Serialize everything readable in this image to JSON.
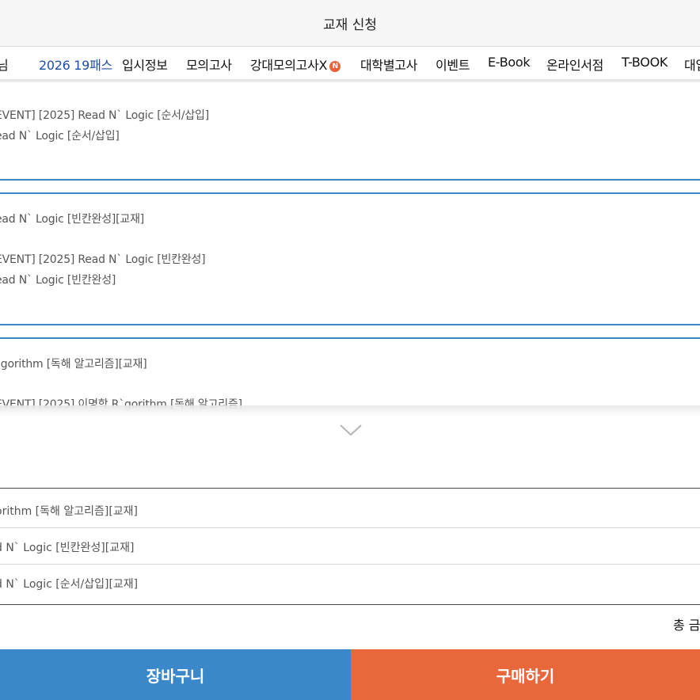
{
  "header": {
    "title": "교재 신청"
  },
  "nav": {
    "items": [
      {
        "label": "님",
        "active": false
      },
      {
        "label": "2026 19패스",
        "active": true
      },
      {
        "label": "입시정보",
        "active": false
      },
      {
        "label": "모의고사",
        "active": false
      },
      {
        "label": "강대모의고사X",
        "active": false,
        "badge": "N"
      },
      {
        "label": "대학별고사",
        "active": false
      },
      {
        "label": "이벤트",
        "active": false
      },
      {
        "label": "E-Book",
        "active": false
      },
      {
        "label": "온라인서점",
        "active": false
      },
      {
        "label": "T-BOOK",
        "active": false
      },
      {
        "label": "대입",
        "active": false
      }
    ]
  },
  "cards": [
    {
      "line1": "EVENT] [2025] Read N` Logic [순서/삽입]",
      "line2": "ead N` Logic [순서/삽입]",
      "bold": "!"
    },
    {
      "title": "ead N` Logic [빈칸완성][교재]",
      "line1": "EVENT] [2025] Read N` Logic [빈칸완성]",
      "line2": "ead N` Logic [빈칸완성]",
      "bold": "!"
    },
    {
      "title": "`gorithm [독해 알고리즘][교재]",
      "line1": "EVENT] [2025] 이명학 R`gorithm [독해 알고리즘]"
    }
  ],
  "selected_items": [
    "orithm [독해 알고리즘][교재]",
    "d N` Logic [빈칸완성][교재]",
    "d N` Logic [순서/삽입][교재]"
  ],
  "total_label": "총 금",
  "buttons": {
    "cart": "장바구니",
    "buy": "구매하기"
  },
  "colors": {
    "accent_blue": "#3a87c9",
    "accent_orange": "#e8683c",
    "nav_active": "#1f4fa3",
    "badge": "#e8623a"
  },
  "icons": {
    "expand": "chevron-down-icon"
  }
}
